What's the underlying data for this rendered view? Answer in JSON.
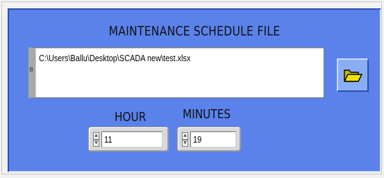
{
  "panel": {
    "title": "MAINTENANCE SCHEDULE FILE"
  },
  "file": {
    "path": "C:\\Users\\Ballu\\Desktop\\SCADA new\\test.xlsx",
    "scroll_indicator": "8"
  },
  "browse_button": {
    "icon": "folder-open-icon"
  },
  "hour": {
    "label": "HOUR",
    "value": "11"
  },
  "minutes": {
    "label": "MINUTES",
    "value": "19"
  },
  "colors": {
    "panel_blue": "#5b82ea",
    "button_blue": "#8aaef5",
    "folder_yellow": "#f5e100"
  }
}
